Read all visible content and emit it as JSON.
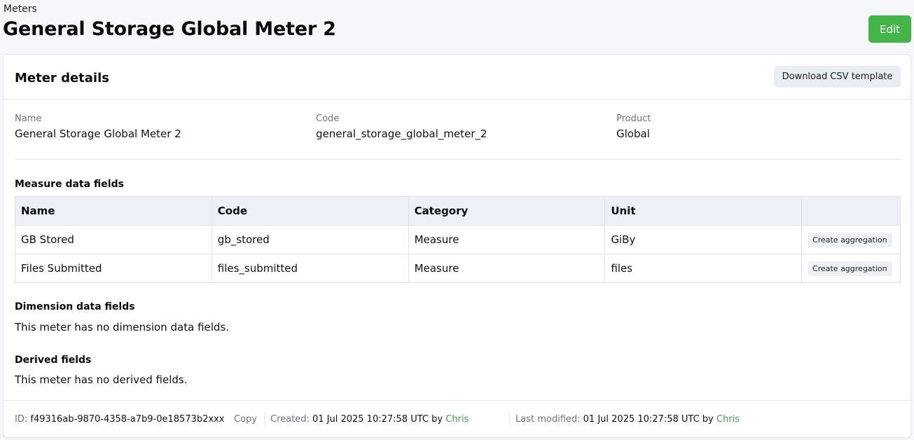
{
  "breadcrumb": "Meters",
  "page_title": "General Storage Global Meter 2",
  "edit_label": "Edit",
  "card": {
    "title": "Meter details",
    "download_label": "Download CSV template"
  },
  "details": {
    "name_label": "Name",
    "name_value": "General Storage Global Meter 2",
    "code_label": "Code",
    "code_value": "general_storage_global_meter_2",
    "product_label": "Product",
    "product_value": "Global"
  },
  "measure": {
    "title": "Measure data fields",
    "headers": [
      "Name",
      "Code",
      "Category",
      "Unit",
      ""
    ],
    "rows": [
      {
        "name": "GB Stored",
        "code": "gb_stored",
        "category": "Measure",
        "unit": "GiBy",
        "action": "Create aggregation"
      },
      {
        "name": "Files Submitted",
        "code": "files_submitted",
        "category": "Measure",
        "unit": "files",
        "action": "Create aggregation"
      }
    ]
  },
  "dimension": {
    "title": "Dimension data fields",
    "text": "This meter has no dimension data fields."
  },
  "derived": {
    "title": "Derived fields",
    "text": "This meter has no derived fields."
  },
  "footer": {
    "id_label": "ID:",
    "id_value": "f49316ab-9870-4358-a7b9-0e18573b2xxx",
    "copy_label": "Copy",
    "created_label": "Created:",
    "created_value": "01 Jul 2025 10:27:58 UTC by",
    "created_by": "Chris",
    "modified_label": "Last modified:",
    "modified_value": "01 Jul 2025 10:27:58 UTC by",
    "modified_by": "Chris"
  },
  "colors": {
    "accent_green": "#44b649",
    "link_green": "#44a04a"
  }
}
